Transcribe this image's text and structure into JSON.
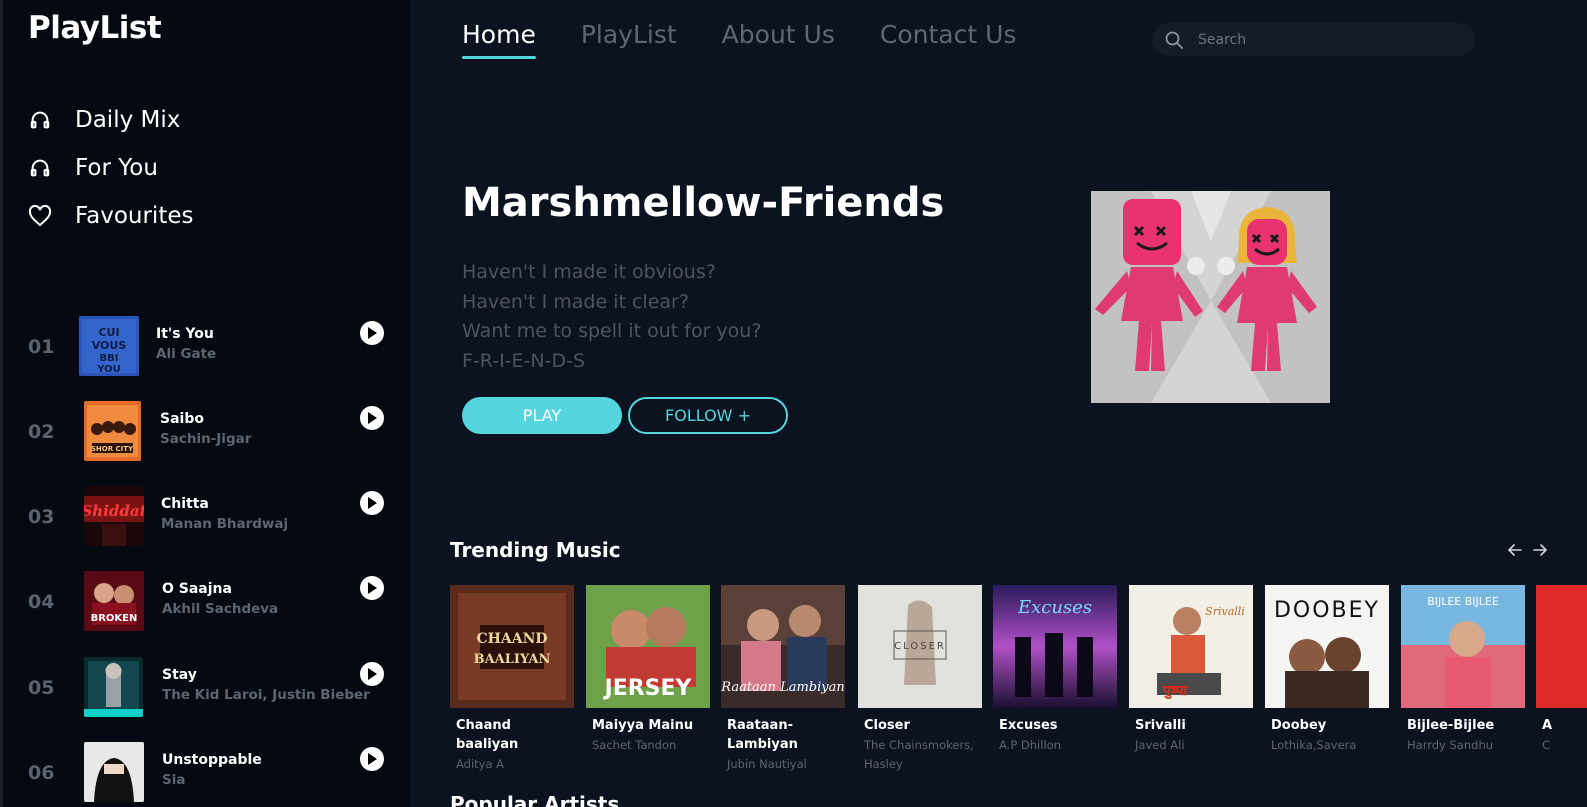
{
  "app": {
    "brand": "PlayList"
  },
  "sidebar": {
    "nav": [
      {
        "label": "Daily Mix",
        "icon": "headphones-icon"
      },
      {
        "label": "For You",
        "icon": "headphones-icon"
      },
      {
        "label": "Favourites",
        "icon": "heart-icon"
      }
    ],
    "tracks": [
      {
        "num": "01",
        "title": "It's You",
        "artist": "Ali Gate"
      },
      {
        "num": "02",
        "title": "Saibo",
        "artist": "Sachin-Jigar"
      },
      {
        "num": "03",
        "title": "Chitta",
        "artist": "Manan Bhardwaj"
      },
      {
        "num": "04",
        "title": "O Saajna",
        "artist": "Akhil Sachdeva"
      },
      {
        "num": "05",
        "title": "Stay",
        "artist": "The Kid Laroi, Justin Bieber"
      },
      {
        "num": "06",
        "title": "Unstoppable",
        "artist": "Sia"
      }
    ]
  },
  "topnav": {
    "tabs": [
      "Home",
      "PlayList",
      "About Us",
      "Contact Us"
    ],
    "active": "Home"
  },
  "search": {
    "placeholder": "Search"
  },
  "hero": {
    "title": "Marshmellow-Friends",
    "lyrics": [
      "Haven't I made it obvious?",
      "Haven't I made it clear?",
      "Want me to spell it out for you?",
      "F-R-I-E-N-D-S"
    ],
    "play_label": "PLAY",
    "follow_label": "FOLLOW +"
  },
  "trending": {
    "title": "Trending Music",
    "cards": [
      {
        "name": "Chaand baaliyan",
        "artist": "Aditya A",
        "cover_text": "CHAAND BAALIYAN"
      },
      {
        "name": "Maiyya Mainu",
        "artist": "Sachet Tandon",
        "cover_text": "JERSEY"
      },
      {
        "name": "Raataan-Lambiyan",
        "artist": "Jubin Nautiyal",
        "cover_text": "Raataan Lambiyan"
      },
      {
        "name": "Closer",
        "artist": "The Chainsmokers, Hasley",
        "cover_text": "CLOSER"
      },
      {
        "name": "Excuses",
        "artist": "A.P Dhillon",
        "cover_text": "Excuses"
      },
      {
        "name": "Srivalli",
        "artist": "Javed Ali",
        "cover_text": "Srivalli"
      },
      {
        "name": "Doobey",
        "artist": "Lothika,Savera",
        "cover_text": "DOOBEY"
      },
      {
        "name": "Bijlee-Bijlee",
        "artist": "Harrdy Sandhu",
        "cover_text": "BIJLEE BIJLEE"
      },
      {
        "name": "A",
        "artist": "C",
        "cover_text": ""
      }
    ]
  },
  "next_section": {
    "title": "Popular Artists"
  },
  "colors": {
    "accent": "#55d6df",
    "background": "#0b1220",
    "sidebar": "#050a12",
    "muted": "#5d6573"
  }
}
